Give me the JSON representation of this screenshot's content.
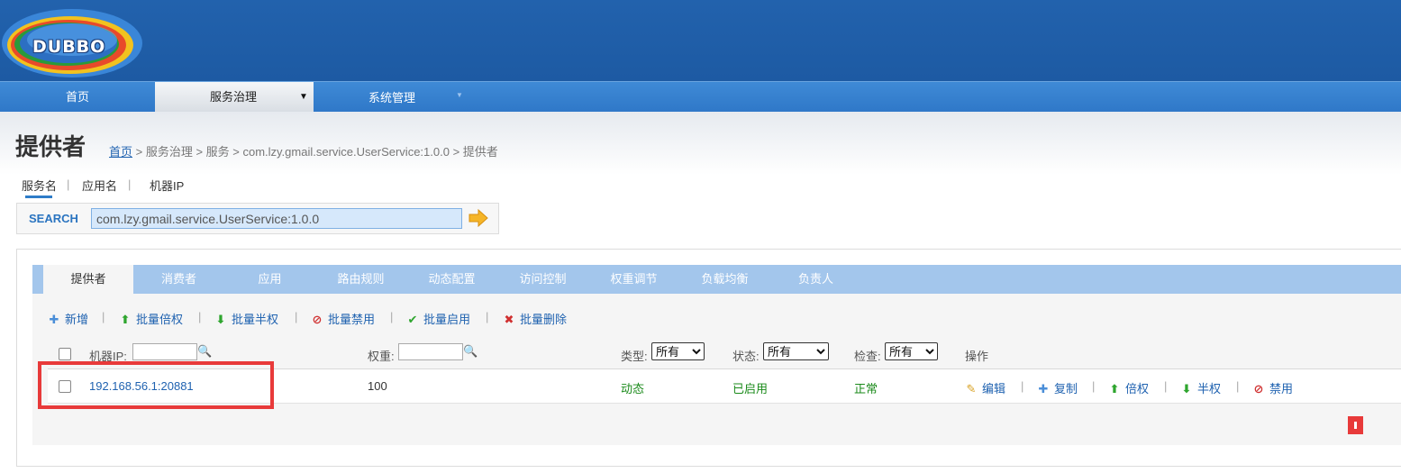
{
  "header": {
    "logo_text": "DUBBO"
  },
  "nav": {
    "items": [
      {
        "label": "首页",
        "has_caret": false
      },
      {
        "label": "服务治理",
        "has_caret": true,
        "active": true,
        "caret": "▼"
      },
      {
        "label": "系统管理",
        "has_caret": true,
        "caret": "▼"
      }
    ]
  },
  "page": {
    "title": "提供者",
    "breadcrumb": {
      "home": "首页",
      "rest": " > 服务治理 > 服务 > com.lzy.gmail.service.UserService:1.0.0 > 提供者"
    }
  },
  "search": {
    "tabs": [
      {
        "label": "服务名",
        "active": true
      },
      {
        "label": "应用名"
      },
      {
        "label": "机器IP"
      }
    ],
    "separator": "|",
    "label": "SEARCH",
    "value": "com.lzy.gmail.service.UserService:1.0.0",
    "go_icon": "arrow-right-icon"
  },
  "tabs": [
    {
      "label": "提供者",
      "active": true
    },
    {
      "label": "消费者"
    },
    {
      "label": "应用"
    },
    {
      "label": "路由规则"
    },
    {
      "label": "动态配置"
    },
    {
      "label": "访问控制"
    },
    {
      "label": "权重调节"
    },
    {
      "label": "负载均衡"
    },
    {
      "label": "负责人"
    }
  ],
  "toolbar": {
    "separator": "|",
    "actions": [
      {
        "label": "新增",
        "icon": "plus-icon",
        "glyph": "✚"
      },
      {
        "label": "批量倍权",
        "icon": "arrow-up-icon",
        "glyph": "⬆"
      },
      {
        "label": "批量半权",
        "icon": "arrow-down-icon",
        "glyph": "⬇"
      },
      {
        "label": "批量禁用",
        "icon": "ban-icon",
        "glyph": "⊘"
      },
      {
        "label": "批量启用",
        "icon": "check-icon",
        "glyph": "✔"
      },
      {
        "label": "批量删除",
        "icon": "delete-icon",
        "glyph": "✖"
      }
    ]
  },
  "table": {
    "headers": {
      "ip": "机器IP:",
      "weight": "权重:",
      "type": "类型:",
      "status": "状态:",
      "check": "检查:",
      "ops": "操作"
    },
    "filters": {
      "type_selected": "所有",
      "status_selected": "所有",
      "check_selected": "所有"
    },
    "search_glyph": "🔍",
    "rows": [
      {
        "ip": "192.168.56.1:20881",
        "weight": "100",
        "type": "动态",
        "status": "已启用",
        "check": "正常",
        "ops": [
          {
            "label": "编辑",
            "icon": "edit-icon",
            "glyph": "✎"
          },
          {
            "label": "复制",
            "icon": "plus-icon",
            "glyph": "✚"
          },
          {
            "label": "倍权",
            "icon": "arrow-up-icon",
            "glyph": "⬆"
          },
          {
            "label": "半权",
            "icon": "arrow-down-icon",
            "glyph": "⬇"
          },
          {
            "label": "禁用",
            "icon": "ban-icon",
            "glyph": "⊘"
          }
        ]
      }
    ]
  },
  "colors": {
    "header_bg": "#2262ad",
    "nav_bg": "#3f8ad6",
    "tab_bar": "#a3c6ec",
    "link": "#1f62b0",
    "green_status": "#1a8a1a",
    "annotation_red": "#e83a3a"
  }
}
